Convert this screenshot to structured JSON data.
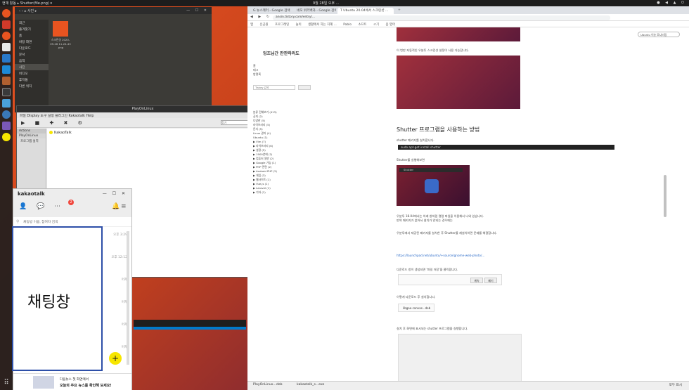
{
  "topbar": {
    "left": "현재 활동  ▸  Shutter(file.png) ▾",
    "center": "9월 28일 오후 ...",
    "right": "● ◀ ▲ ⏻"
  },
  "dock": {
    "grid_icon": "⠿"
  },
  "file_manager": {
    "nav": "‹  ›  ⌂ 사진  ▸",
    "window_controls": "— ☐ ✕",
    "sidebar": [
      "최근",
      "즐겨찾기",
      "홈",
      "바탕 화면",
      "다운로드",
      "문서",
      "음악",
      "사진",
      "비디오",
      "휴지통",
      "다른 위치"
    ],
    "selected_index": 7,
    "file_name": "스크린샷 2020-09-28 11-24-43 .png"
  },
  "playonlinux": {
    "title": "PlayOnLinux",
    "menu": "파일  Display  도구  설정  플러그인  Kakaotalk  Help",
    "toolbar": "▶ ■ ✚ ✖ ⚙",
    "search_placeholder": "찾기",
    "left_header": "Actions",
    "left_app": "PlayOnLinux",
    "left_item": "프로그램 설치",
    "app_name": "KakaoTalk"
  },
  "browser": {
    "tabs": [
      "G 뉴스레터 - Google 검색",
      "네모 위키백과 - Google 검색",
      "T Ubuntu 20.04에서 스크린샷 ...",
      "",
      "+"
    ],
    "nav": "◀ ▶ ↻",
    "url": "ansin.tistory.com/entry/...",
    "bookmarks": [
      "앱",
      "신공원",
      "프로그래밍",
      "놀이",
      "생활에서 하는 지혜 ...",
      "Pablo",
      "소프트",
      "ㄹ기",
      "음 영어"
    ],
    "blog_title": "잉조님간 판판하러도",
    "blog_nav": [
      "홈",
      "태그",
      "방명록"
    ],
    "search_placeholder": "Tistory 검색",
    "categories": [
      "분류 전체보기 (413)",
      "공지 (2)",
      "다양한 (5)",
      "라이브러리 (5)",
      "문서 (5)",
      "Linux 관리 (4)",
      "Ubuntu (1)",
      "▶ Vim (7)",
      "▶ 라이브러리 (6)",
      "▶ 설정 (5)",
      "▶ 1900년에 (2)",
      "▶ 컴퓨터 일반 (2)",
      "▶ Google 가능 (1)",
      "▶ PHP 관련 (2)",
      "▶ Android PHP (2)",
      "▶ 게임 (3)",
      "▶ 웹사이트 (1)",
      "▶ Vue.js (1)",
      "▶ Laravel (1)",
      "▶ 기타 (1)"
    ],
    "article": {
      "heading": "Shutter 프로그램을 사용하는 방법",
      "p1": "이 번만 자동적인 우분투 스크린샷 설정이 사용 가능합니다.",
      "p2": "shutter 패키지를 설치합니다.",
      "code": "sudo apt-get install shutter",
      "p3": "Shutter를 실행해보면",
      "p4": "우분투 18.04에서는 아래 창처럼 명령 파일을 이용해서 나와 있습니다.",
      "p5": "만약 패키지가 없어서 설치가 안되는 경우에는",
      "p6": "우분투에서 제공된 패키지를 설치한 후 Shutter를 재설치하면 문제를 해결합니다.",
      "link": "https://launchpad.net/ubuntu/+source/gnome-web-photo/...",
      "p7": "다운로드 창이 생성되면 '파일 저장'을 클릭합니다.",
      "p8": "이렇게 다운로드 후 설치합니다.",
      "dl_file": "libgoo-canvas...deb",
      "dl_keep": "계속",
      "dl_discard": "폐기",
      "search_overlay": "Shutter",
      "final": "설치 후 화면에 표시되는 shutter 프로그램을 실행합니다."
    },
    "right_pill": "Ubuntu 이슈 모니터링"
  },
  "kakaotalk": {
    "logo": "kakaotalk",
    "window_controls": "— ☐ ✕",
    "badge": "2",
    "search_placeholder": "채팅방 이름, 참여자 검색",
    "times": [
      "오후 3:29",
      "오후 12:12",
      "어제",
      "어제",
      "어제",
      "어제",
      "어제",
      "어제"
    ],
    "chat_panel_label": "채팅창",
    "fab": "+",
    "ad_line1": "다음뉴스 첫 화면에서",
    "ad_line2": "오늘의 주요 뉴스를 확인해 보세요!"
  },
  "taskbar": {
    "items": [
      "PlayOnLinux...deb",
      "kakaotalk_s...exe"
    ],
    "show_all": "모두 표시"
  },
  "colors": {
    "ubuntu_orange": "#e95420",
    "kakao_yellow": "#f7e600",
    "highlight_border": "#2d4fa8"
  }
}
